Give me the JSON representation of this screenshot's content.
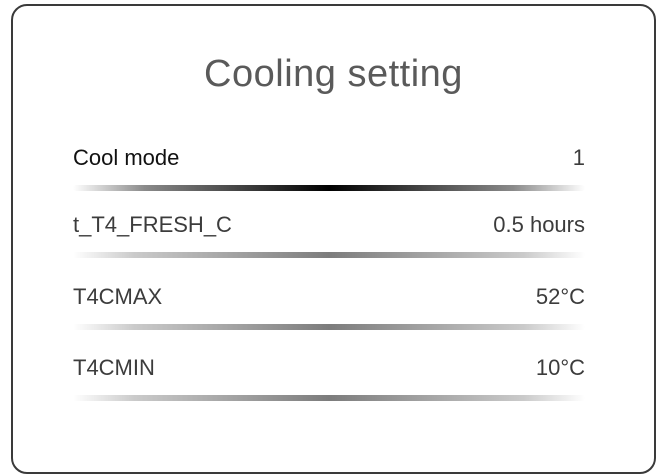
{
  "panel": {
    "title": "Cooling setting"
  },
  "settings": [
    {
      "label": "Cool mode",
      "value": "1",
      "selected": true
    },
    {
      "label": "t_T4_FRESH_C",
      "value": "0.5 hours",
      "selected": false
    },
    {
      "label": "T4CMAX",
      "value": "52°C",
      "selected": false
    },
    {
      "label": "T4CMIN",
      "value": "10°C",
      "selected": false
    }
  ],
  "colors": {
    "border": "#3a3a3a",
    "title": "#5a5a5a",
    "text": "#3c3c3c",
    "selected_divider": "#000000"
  }
}
